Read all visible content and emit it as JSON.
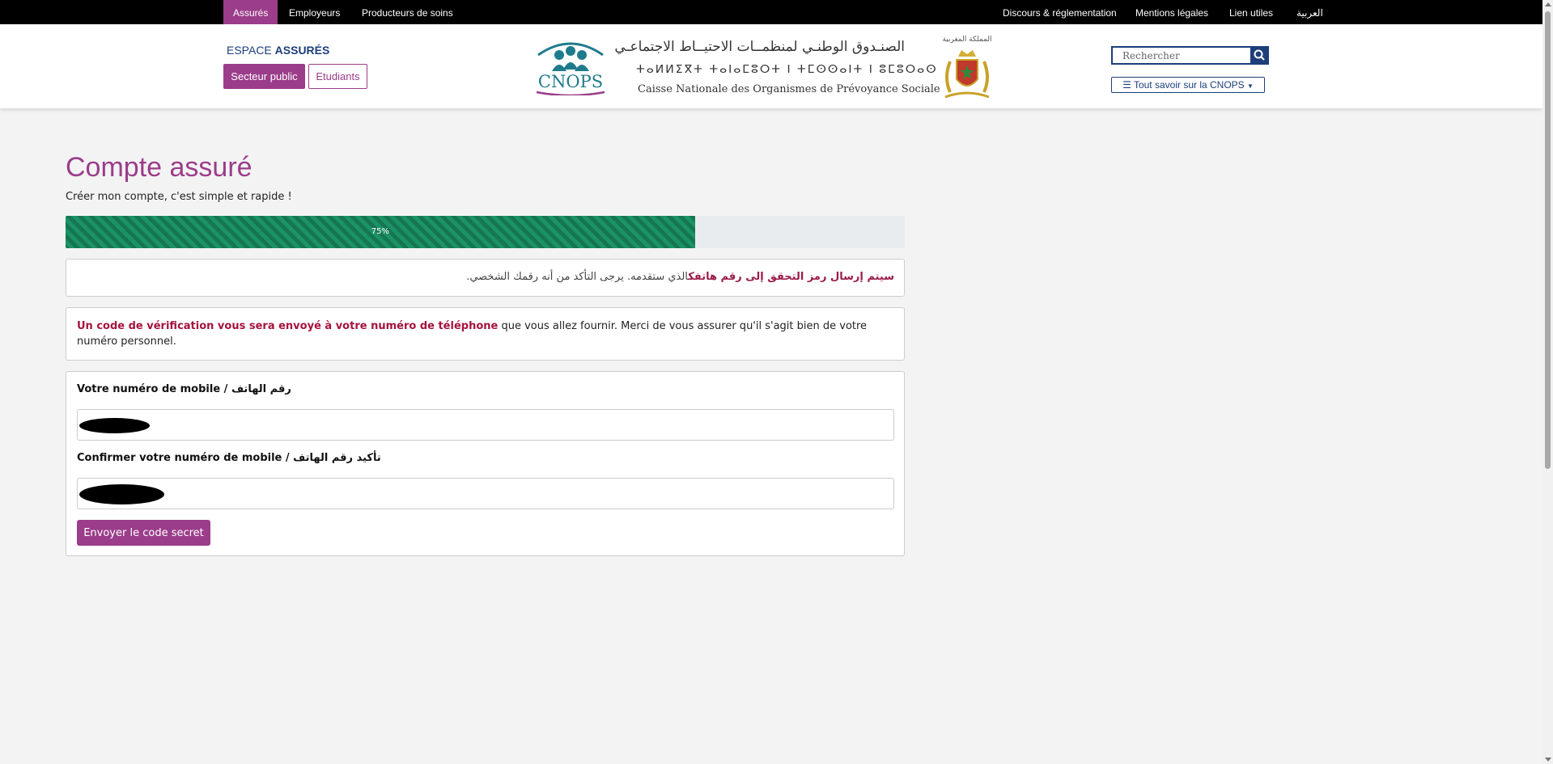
{
  "topnav": {
    "left": [
      "Assurés",
      "Employeurs",
      "Producteurs de soins"
    ],
    "right": [
      "Discours & réglementation",
      "Mentions légales",
      "Lien utiles",
      "العربية"
    ]
  },
  "header": {
    "espace_prefix": "ESPACE",
    "espace_strong": "ASSURÉS",
    "btn_public": "Secteur public",
    "btn_etudiants": "Etudiants",
    "logo_text": "CNOPS",
    "brand_ar": "الصنـدوق الوطنـي لمنظمــات الاحتيــاط الاجتماعـي",
    "brand_tif": "ⵜⴰⵍⵍⵉⴳⵜ ⵜⴰⵏⴰⵎⵓⵔⵜ ⵏ ⵜⵎⵙⵙⴰⵏⵜ ⵏ ⵓⵎⵓⵔⴰⵙ",
    "brand_fr": "Caisse Nationale des Organismes de Prévoyance Sociale",
    "kingdom_label": "المملكة المغربية",
    "search_placeholder": "Rechercher",
    "tout_savoir": "Tout savoir sur la CNOPS"
  },
  "main": {
    "title": "Compte assuré",
    "subtitle": "Créer mon compte, c'est simple et rapide !",
    "progress_label": "75%",
    "progress_value": 0.75,
    "info_ar_strong": "سيتم إرسال رمز التحقق إلى رقم هاتفك",
    "info_ar_rest": "الذي ستقدمه. يرجى التأكد من أنه رقمك الشخصي.",
    "info_fr_strong": "Un code de vérification vous sera envoyé à votre numéro de téléphone",
    "info_fr_rest": " que vous allez fournir. Merci de vous assurer qu'il s'agit bien de votre numéro personnel.",
    "mobile_label": "Votre numéro de mobile / رقم الهاتف",
    "confirm_label": "Confirmer votre numéro de mobile / تأكيد رقم الهاتف",
    "mobile_value": "",
    "confirm_value": "",
    "send_button": "Envoyer le code secret"
  },
  "colors": {
    "accent": "#9b3d8a",
    "brand_blue": "#1c3f7a",
    "progress_green": "#1b9366",
    "alert_red": "#a5123d"
  },
  "icons": [
    "search-icon",
    "menu-icon",
    "caret-down-icon"
  ]
}
